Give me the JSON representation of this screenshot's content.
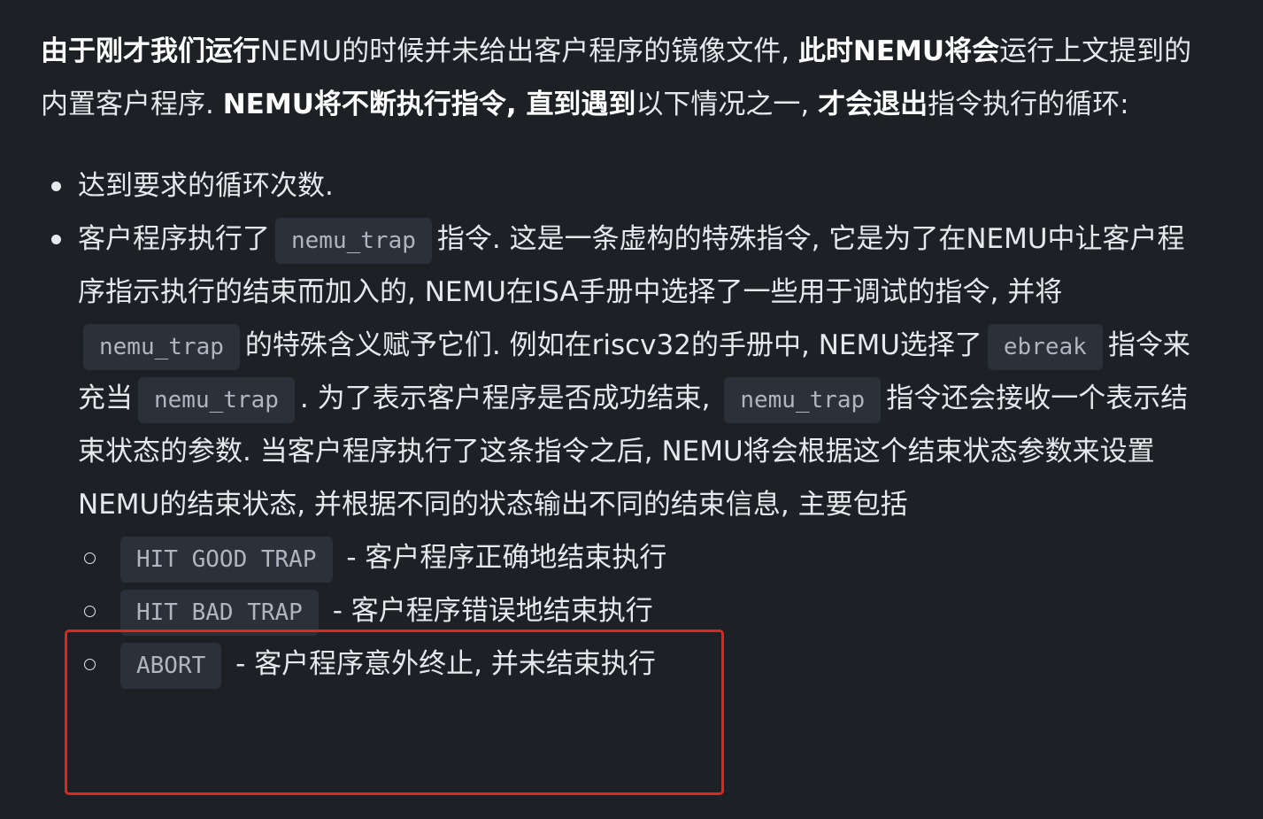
{
  "intro": {
    "t1": "由于刚才我们运行",
    "t2": "NEMU的时候并未给出客户程序的镜像文件, ",
    "t3": "此时NEMU将会",
    "t4": "运行上文提到的内置客户程序. ",
    "t5": "NEMU将不断执行指令, ",
    "t6": "直到遇到",
    "t7": "以下情况之一, ",
    "t8": "才会退出",
    "t9": "指令执行的循环:"
  },
  "bullet1": {
    "t1": "达到要求",
    "t2": "的循环次数."
  },
  "bullet2": {
    "t1": "客户程序",
    "t2": "执行了",
    "code1": "nemu_trap",
    "t3": "指令",
    "t4": ". ",
    "t5": "这是一条",
    "t6": "虚构的特殊指令, ",
    "t7": "它是为了在NEMU中",
    "t8": "让客户程序指示执行的结束而加入的, ",
    "t9": "NEMU在",
    "t10": "ISA手册中选择了一些用于调试的指令, ",
    "t11": "并将",
    "code2": "nemu_trap",
    "t12": "的特殊含",
    "t13": "义赋予它们. ",
    "t14": "例如在",
    "t15": "riscv32",
    "t16": "的手",
    "t17": "册中, ",
    "t18": "NEMU选择了",
    "code3": "ebreak",
    "t19": "指令",
    "t20": "来充当",
    "code4": "nemu_trap",
    "t21": ". ",
    "t22": "为了表示客户",
    "t23": "程序是否成功结束, ",
    "code5": "nemu_trap",
    "t24": "指令还会接收",
    "t25": "一个表示结束状态的参数. ",
    "t26": "当客户程序执",
    "t27": "行了这条指令之后, ",
    "t28": "NEMU将会根据这个",
    "t29": "结束状态参数来设置NEMU的结束状态, ",
    "t30": "并根据不同的",
    "t31": "状态输出不同的结束信息, ",
    "t32": "主要",
    "t33": "包括"
  },
  "sub_items": [
    {
      "code": "HIT GOOD TRAP",
      "dash": " - ",
      "bold": "客户程序",
      "rest": "正确地结束执行"
    },
    {
      "code": "HIT BAD TRAP",
      "dash": " - ",
      "bold": "客户程序",
      "rest": "错误地结束执行"
    },
    {
      "code": "ABORT",
      "dash": " - ",
      "bold": "客户程序",
      "rest": "意外终止, ",
      "bold2": "并未",
      "rest2": "结束执行"
    }
  ],
  "colors": {
    "background": "#1d2025",
    "text": "#e6e8eb",
    "code_bg": "#2c3038",
    "code_text": "#aeb6c2",
    "highlight_border": "#e5251c"
  }
}
